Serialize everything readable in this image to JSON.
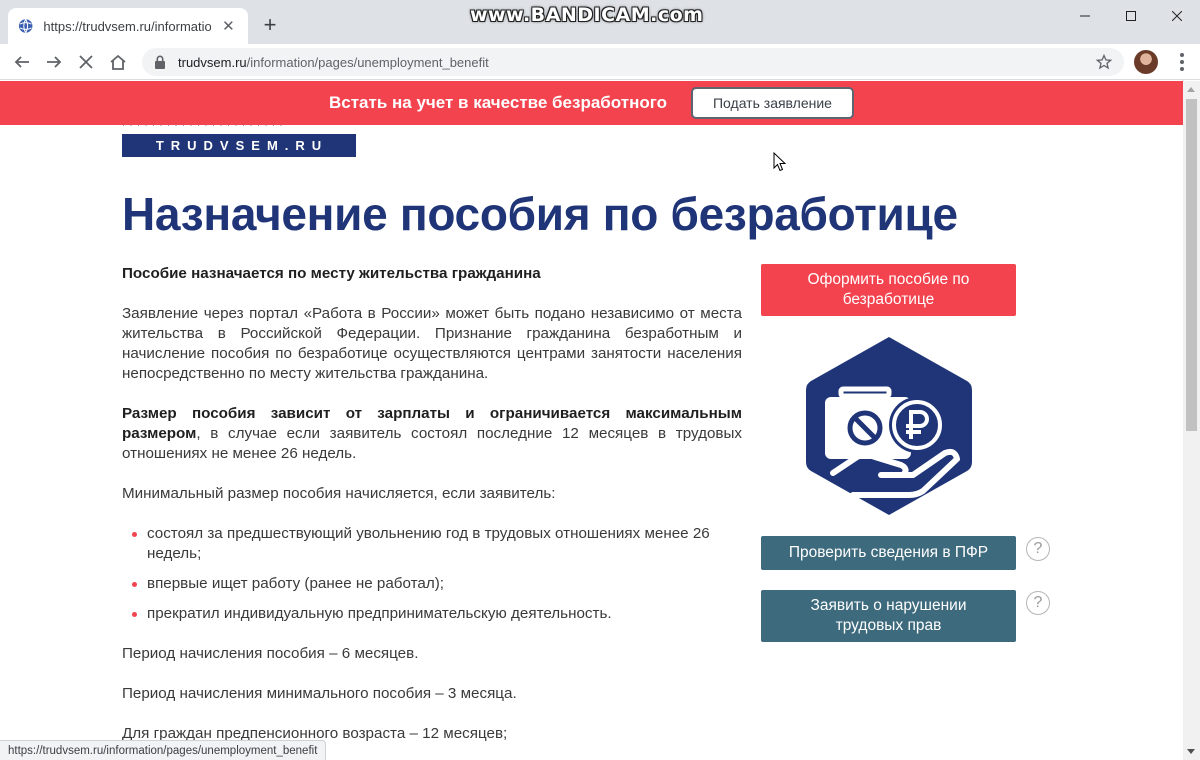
{
  "window": {
    "watermark": "www.BANDICAM.com"
  },
  "tab": {
    "title": "https://trudvsem.ru/information/",
    "close_glyph": "✕",
    "new_tab_glyph": "+"
  },
  "address_bar": {
    "domain": "trudvsem.ru",
    "path": "/information/pages/unemployment_benefit"
  },
  "banner": {
    "text": "Встать на учет в качестве безработного",
    "button_label": "Подать заявление"
  },
  "logo": {
    "text": "TRUDVSEM.RU"
  },
  "page": {
    "title": "Назначение пособия по безработице",
    "lead": "Пособие назначается по месту жительства гражданина",
    "paragraph_1": "Заявление через портал «Работа в России» может быть подано независимо от места жительства в Российской Федерации. Признание гражданина безработным и начисление пособия по безработице осуществляются центрами занятости населения непосредственно по месту жительства гражданина.",
    "paragraph_2_bold": "Размер пособия зависит от зарплаты и ограничивается максимальным размером",
    "paragraph_2_rest": ", в случае если заявитель состоял последние 12 месяцев в трудовых отношениях не менее 26 недель.",
    "paragraph_3": "Минимальный размер пособия начисляется, если заявитель:",
    "bullets": [
      "состоял за предшествующий увольнению год в трудовых отношениях менее 26 недель;",
      "впервые ищет работу (ранее не работал);",
      "прекратил индивидуальную предпринимательскую деятельность."
    ],
    "period_1": "Период начисления пособия – 6 месяцев.",
    "period_2": "Период начисления минимального пособия – 3 месяца.",
    "period_3": "Для граждан предпенсионного возраста – 12 месяцев;"
  },
  "sidebar": {
    "apply_button": "Оформить пособие по безработице",
    "pfr_button": "Проверить сведения в ПФР",
    "rights_button": "Заявить о нарушении трудовых прав",
    "help_glyph": "?"
  },
  "status_bar": {
    "url": "https://trudvsem.ru/information/pages/unemployment_benefit"
  },
  "colors": {
    "brand_red": "#f2434f",
    "brand_navy": "#1f3577",
    "button_teal": "#3d6a7c"
  },
  "icons": {
    "favicon": "globe-icon",
    "back": "arrow-left-icon",
    "forward": "arrow-right-icon",
    "stop": "close-icon",
    "home": "home-icon",
    "lock": "lock-icon",
    "bookmark": "star-icon",
    "menu": "kebab-menu-icon",
    "hero": "briefcase-ruble-hand-icon"
  }
}
